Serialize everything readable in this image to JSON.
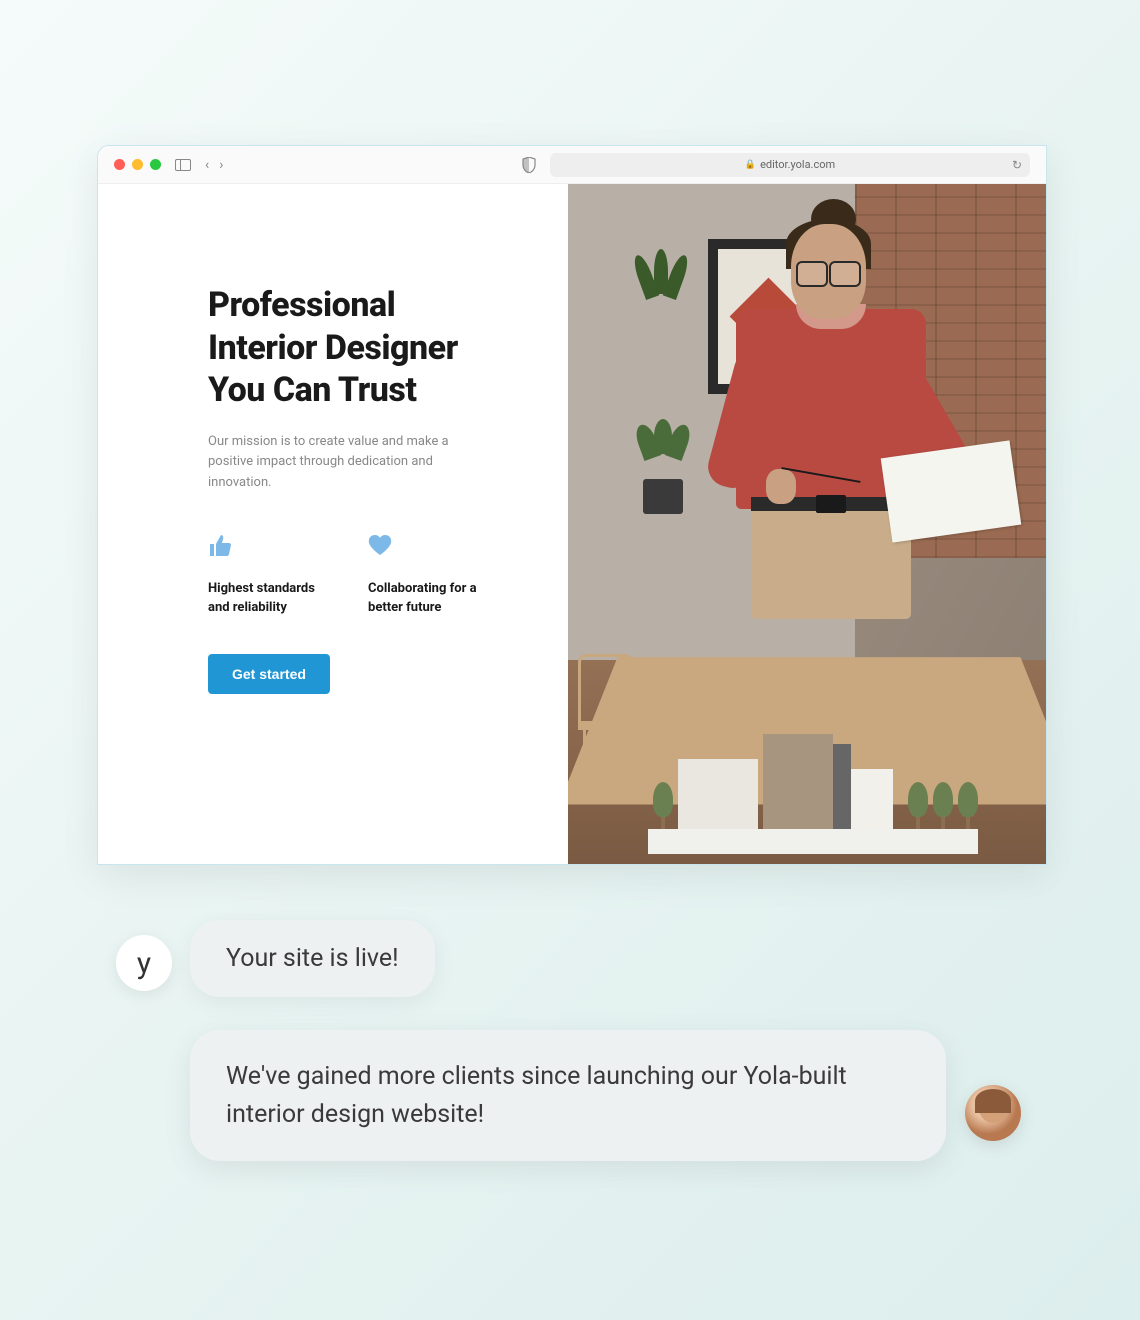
{
  "browser": {
    "url": "editor.yola.com"
  },
  "hero": {
    "title_line1": "Professional",
    "title_line2": "Interior Designer",
    "title_line3": "You Can Trust",
    "description": "Our mission is to create value and make a positive impact through dedication and innovation.",
    "cta_label": "Get started"
  },
  "features": [
    {
      "text": "Highest standards and reliability"
    },
    {
      "text": "Collaborating for a better future"
    }
  ],
  "chat": {
    "system_avatar_letter": "y",
    "bubble1": "Your site is live!",
    "bubble2": "We've gained more clients since launching our Yola-built interior design website!"
  }
}
